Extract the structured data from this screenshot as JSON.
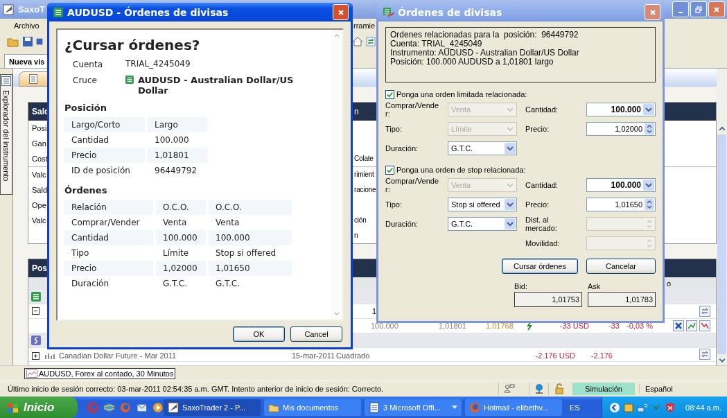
{
  "main_window": {
    "title": "SaxoT",
    "menu": [
      "Archivo",
      "rramie"
    ],
    "tab": "Nueva vis",
    "sidebar_label": "Explorador del instrumento",
    "balance_panel": {
      "header": "Salc",
      "header_right": "n",
      "rows": [
        {
          "left": "Posi"
        },
        {
          "left": "Gan"
        },
        {
          "left": "Cost",
          "right": "Colate"
        },
        {
          "left": "Valc",
          "right": "rimient"
        },
        {
          "left": "Sald",
          "right": "racione"
        },
        {
          "left": "Ope"
        },
        {
          "left": "Valc",
          "right": "ción"
        },
        {
          "right": "n"
        }
      ]
    },
    "positions_panel": {
      "header": "Pos",
      "columns": [
        "o"
      ],
      "rows": [
        {
          "kind": "fxgroup"
        },
        {
          "kind": "parent",
          "expanded": true,
          "amount": "1"
        },
        {
          "kind": "position",
          "amount": "100.000",
          "open_price": "1,01801",
          "current_price": "1,01768",
          "pnl": "-33 USD",
          "pnl_base": "-33",
          "pnl_pct": "-0,03 %"
        },
        {
          "kind": "futuresgroup"
        },
        {
          "kind": "parent",
          "expanded": false,
          "name": "Canadian Dollar Future - Mar 2011",
          "date": "15-mar-2011",
          "status": "Cuadrado",
          "pnl": "-2.176 USD",
          "pnl_base": "-2.176"
        }
      ]
    },
    "chart_tab": "AUDUSD, Forex al contado, 30 Minutos",
    "status_bar": {
      "message": "Último inicio de sesión correcto: 03-mar-2011 02:54:35 a.m. GMT. Intento anterior de inicio de sesión: Correcto.",
      "mode": "Simulación",
      "language": "Español"
    }
  },
  "confirm_dialog": {
    "title": "AUDUSD - Órdenes de divisas",
    "heading": "¿Cursar órdenes?",
    "account_label": "Cuenta",
    "account": "TRIAL_4245049",
    "cross_label": "Cruce",
    "cross": "AUDUSD - Australian Dollar/US Dollar",
    "position_title": "Posición",
    "position_rows": [
      {
        "label": "Largo/Corto",
        "value": "Largo"
      },
      {
        "label": "Cantidad",
        "value": "100.000"
      },
      {
        "label": "Precio",
        "value": "1,01801"
      },
      {
        "label": "ID de posición",
        "value": "96449792"
      }
    ],
    "orders_title": "Órdenes",
    "order_rows": [
      {
        "label": "Relación",
        "values": [
          "O.C.O.",
          "O.C.O."
        ]
      },
      {
        "label": "Comprar/Vender",
        "values": [
          "Venta",
          "Venta"
        ]
      },
      {
        "label": "Cantidad",
        "values": [
          "100.000",
          "100.000"
        ]
      },
      {
        "label": "Tipo",
        "values": [
          "Límite",
          "Stop si offered"
        ]
      },
      {
        "label": "Precio",
        "values": [
          "1,02000",
          "1,01650"
        ]
      },
      {
        "label": "Duración",
        "values": [
          "G.T.C.",
          "G.T.C."
        ]
      }
    ],
    "buttons": [
      "OK",
      "Cancel"
    ]
  },
  "orders_dialog": {
    "title": "Órdenes de divisas",
    "info_lines": [
      "Ordenes relacionadas para la  posición:  96449792",
      "Cuenta: TRIAL_4245049",
      "Instrumento: AUDUSD - Australian Dollar/US Dollar",
      "Posición: 100.000 AUDUSD a 1,01801 largo"
    ],
    "sections": [
      {
        "label": "Ponga una orden limitada relacionada:",
        "checked": true,
        "rows": [
          {
            "left": {
              "label": "Comprar/Vender:",
              "value": "Venta",
              "kind": "dropdown",
              "disabled": true
            },
            "right": {
              "label": "Cantidad:",
              "value": "100.000",
              "kind": "amount",
              "disabled": false
            }
          },
          {
            "left": {
              "label": "Tipo:",
              "value": "Límite",
              "kind": "dropdown",
              "disabled": true
            },
            "right": {
              "label": "Precio:",
              "value": "1,02000",
              "kind": "spinner",
              "disabled": false
            }
          },
          {
            "left": {
              "label": "Duración:",
              "value": "G.T.C.",
              "kind": "dropdown",
              "disabled": false
            }
          }
        ]
      },
      {
        "label": "Ponga una orden de stop relacionada:",
        "checked": true,
        "rows": [
          {
            "left": {
              "label": "Comprar/Vender:",
              "value": "Venta",
              "kind": "dropdown",
              "disabled": true
            },
            "right": {
              "label": "Cantidad:",
              "value": "100.000",
              "kind": "amount",
              "disabled": false
            }
          },
          {
            "left": {
              "label": "Tipo:",
              "value": "Stop si offered",
              "kind": "dropdown",
              "disabled": false
            },
            "right": {
              "label": "Precio:",
              "value": "1,01650",
              "kind": "spinner",
              "disabled": false
            }
          },
          {
            "left": {
              "label": "Duración:",
              "value": "G.T.C.",
              "kind": "dropdown",
              "disabled": false
            },
            "right": {
              "label": "Dist. al mercado:",
              "kind": "spinner",
              "disabled": true
            }
          },
          {
            "right": {
              "label": "Movilidad:",
              "kind": "spinner",
              "disabled": true
            }
          }
        ]
      }
    ],
    "buttons": [
      "Cursar órdenes",
      "Cancelar"
    ],
    "bid_label": "Bid:",
    "bid": "1,01753",
    "ask_label": "Ask",
    "ask": "1,01783"
  },
  "taskbar": {
    "start": "Inicio",
    "tasks": [
      {
        "label": "SaxoTrader 2 - P...",
        "kind": "app",
        "selected": true
      },
      {
        "label": "Mis documentos",
        "kind": "folder",
        "selected": false
      },
      {
        "label": "3 Microsoft Offi...",
        "kind": "group",
        "selected": false
      },
      {
        "label": "Hotmail - elibethv...",
        "kind": "browser",
        "selected": false
      }
    ],
    "language": "ES",
    "clock": "08:44 a.m."
  }
}
